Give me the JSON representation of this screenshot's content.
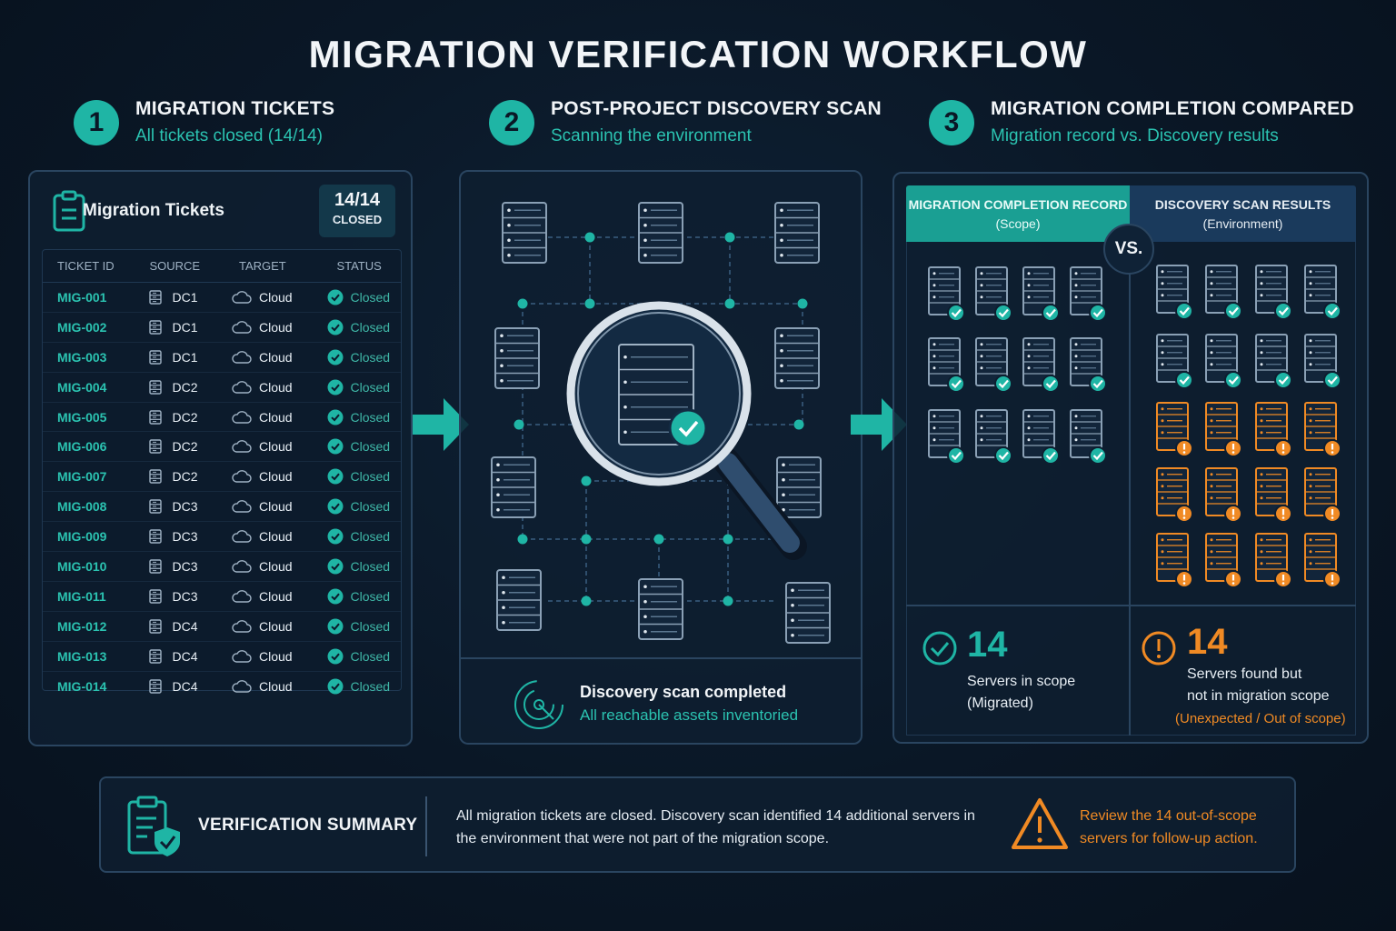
{
  "title": "MIGRATION VERIFICATION WORKFLOW",
  "steps": [
    {
      "num": "1",
      "title": "MIGRATION TICKETS",
      "subtitle": "All tickets closed (14/14)"
    },
    {
      "num": "2",
      "title": "POST-PROJECT DISCOVERY SCAN",
      "subtitle": "Scanning the environment"
    },
    {
      "num": "3",
      "title": "MIGRATION COMPLETION COMPARED",
      "subtitle": "Migration record vs. Discovery results"
    }
  ],
  "tickets": {
    "title": "Migration Tickets",
    "badge_count": "14/14",
    "badge_label": "CLOSED",
    "headers": [
      "TICKET ID",
      "SOURCE",
      "TARGET",
      "STATUS"
    ],
    "rows": [
      {
        "id": "MIG-001",
        "source": "DC1",
        "target": "Cloud",
        "status": "Closed"
      },
      {
        "id": "MIG-002",
        "source": "DC1",
        "target": "Cloud",
        "status": "Closed"
      },
      {
        "id": "MIG-003",
        "source": "DC1",
        "target": "Cloud",
        "status": "Closed"
      },
      {
        "id": "MIG-004",
        "source": "DC2",
        "target": "Cloud",
        "status": "Closed"
      },
      {
        "id": "MIG-005",
        "source": "DC2",
        "target": "Cloud",
        "status": "Closed"
      },
      {
        "id": "MIG-006",
        "source": "DC2",
        "target": "Cloud",
        "status": "Closed"
      },
      {
        "id": "MIG-007",
        "source": "DC2",
        "target": "Cloud",
        "status": "Closed"
      },
      {
        "id": "MIG-008",
        "source": "DC3",
        "target": "Cloud",
        "status": "Closed"
      },
      {
        "id": "MIG-009",
        "source": "DC3",
        "target": "Cloud",
        "status": "Closed"
      },
      {
        "id": "MIG-010",
        "source": "DC3",
        "target": "Cloud",
        "status": "Closed"
      },
      {
        "id": "MIG-011",
        "source": "DC3",
        "target": "Cloud",
        "status": "Closed"
      },
      {
        "id": "MIG-012",
        "source": "DC4",
        "target": "Cloud",
        "status": "Closed"
      },
      {
        "id": "MIG-013",
        "source": "DC4",
        "target": "Cloud",
        "status": "Closed"
      },
      {
        "id": "MIG-014",
        "source": "DC4",
        "target": "Cloud",
        "status": "Closed"
      }
    ]
  },
  "scan": {
    "status_title": "Discovery scan completed",
    "status_sub": "All reachable assets inventoried"
  },
  "compare": {
    "scope_title": "MIGRATION COMPLETION RECORD",
    "scope_sub": "(Scope)",
    "disc_title": "DISCOVERY SCAN RESULTS",
    "disc_sub": "(Environment)",
    "vs": "VS.",
    "scope_count": "14",
    "scope_label_1": "Servers in scope",
    "scope_label_2": "(Migrated)",
    "extra_count": "14",
    "extra_label_1": "Servers found but",
    "extra_label_2": "not in migration scope",
    "extra_note": "(Unexpected / Out of scope)"
  },
  "summary": {
    "title": "VERIFICATION SUMMARY",
    "text": "All migration tickets are closed. Discovery scan identified 14 additional servers in the environment that were not part of the migration scope.",
    "warning": "Review the 14 out-of-scope servers for follow-up action."
  },
  "colors": {
    "accent": "#1fb5a5",
    "warning": "#f08a24",
    "background": "#0a1726",
    "panel_border": "#2a4560"
  }
}
